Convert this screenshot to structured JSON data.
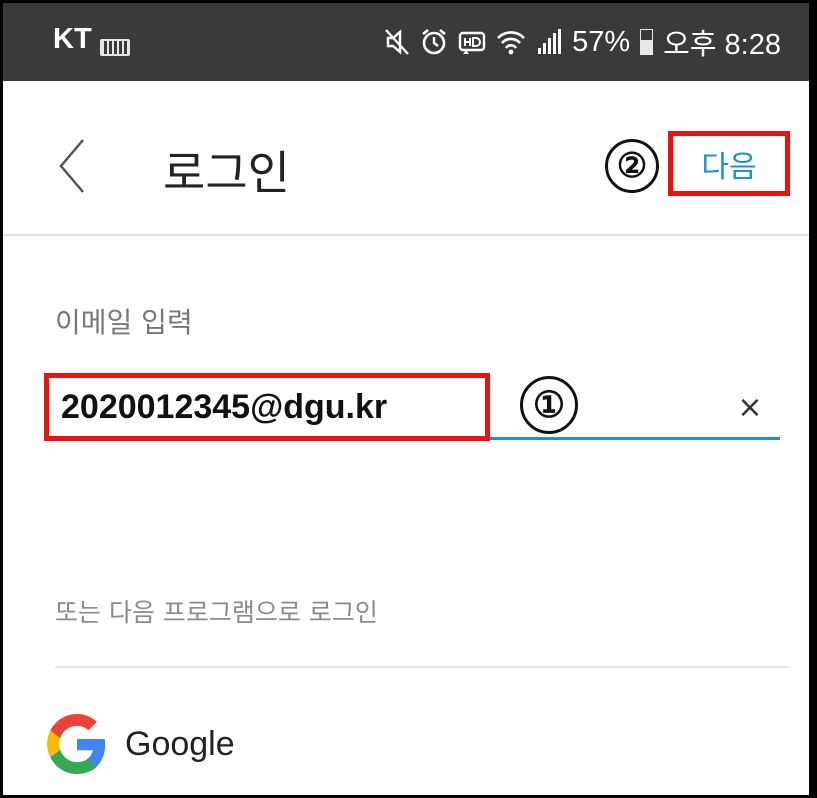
{
  "status_bar": {
    "carrier": "KT",
    "battery_percent": "57%",
    "battery_level": 0.57,
    "time": "오후 8:28",
    "icons": [
      "keyboard-icon",
      "mute-icon",
      "alarm-icon",
      "hd-icon",
      "wifi-icon",
      "signal-icon",
      "battery-icon"
    ]
  },
  "header": {
    "title": "로그인",
    "next_label": "다음",
    "back_icon": "chevron-left-icon"
  },
  "annotations": {
    "mark_1": "①",
    "mark_2": "②",
    "highlight_color": "#ee1111"
  },
  "form": {
    "email_label": "이메일 입력",
    "email_value": "2020012345@dgu.kr",
    "clear_label": "×"
  },
  "alternatives": {
    "label": "또는 다음 프로그램으로 로그인",
    "providers": [
      {
        "name": "Google",
        "icon": "google-logo-icon"
      }
    ]
  },
  "colors": {
    "accent": "#1e90d8",
    "status_bar_bg": "#3a3a3a"
  }
}
